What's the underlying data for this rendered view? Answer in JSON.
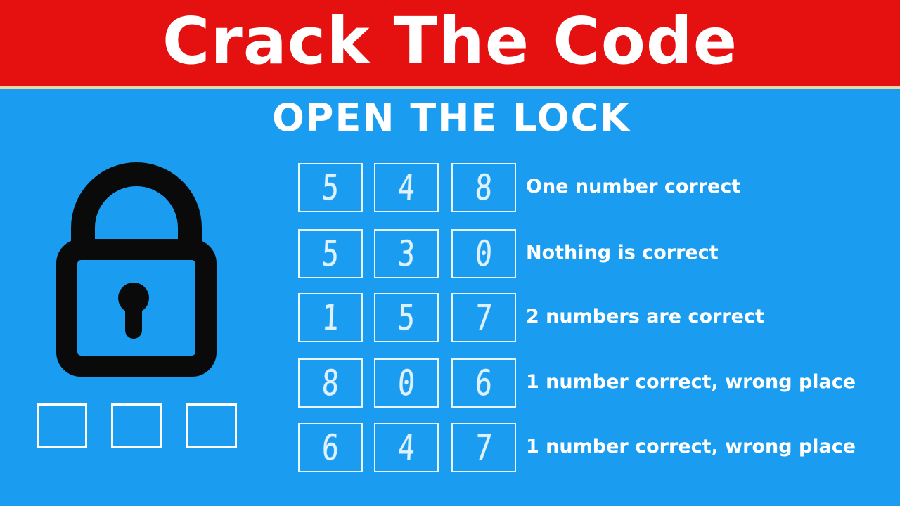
{
  "banner": {
    "title": "Crack The Code"
  },
  "subtitle": "OPEN THE LOCK",
  "colors": {
    "banner_red": "#e51010",
    "background_blue": "#1a9df0",
    "lock_black": "#0a0a0a",
    "text_white": "#ffffff"
  },
  "lock": {
    "icon": "padlock-icon"
  },
  "clues": [
    {
      "digits": [
        "5",
        "4",
        "8"
      ],
      "hint": "One number correct"
    },
    {
      "digits": [
        "5",
        "3",
        "0"
      ],
      "hint": "Nothing is correct"
    },
    {
      "digits": [
        "1",
        "5",
        "7"
      ],
      "hint": "2 numbers are correct"
    },
    {
      "digits": [
        "8",
        "0",
        "6"
      ],
      "hint": "1 number correct, wrong place"
    },
    {
      "digits": [
        "6",
        "4",
        "7"
      ],
      "hint": "1 number correct, wrong place"
    }
  ]
}
